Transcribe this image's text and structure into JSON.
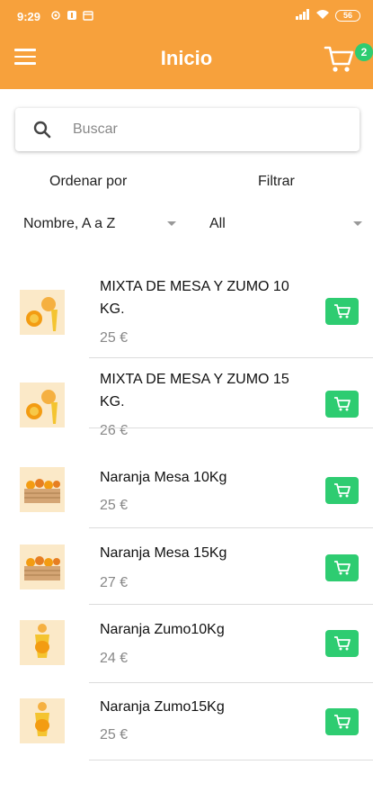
{
  "status_bar": {
    "time": "9:29",
    "battery": "56"
  },
  "app_bar": {
    "title": "Inicio",
    "cart_count": "2"
  },
  "search": {
    "placeholder": "Buscar"
  },
  "sort": {
    "label": "Ordenar por",
    "value": "Nombre, A a Z"
  },
  "filter": {
    "label": "Filtrar",
    "value": "All"
  },
  "colors": {
    "primary": "#f7a13c",
    "accent": "#2ecc71"
  },
  "products": [
    {
      "name": "MIXTA DE MESA Y ZUMO 10 KG.",
      "price": "25 €",
      "image": "mixed-orange-juice-icon"
    },
    {
      "name": "MIXTA DE MESA Y ZUMO 15 KG.",
      "price": "26 €",
      "image": "mixed-orange-juice-icon"
    },
    {
      "name": "Naranja Mesa 10Kg",
      "price": "25 €",
      "image": "orange-crate-icon"
    },
    {
      "name": "Naranja Mesa 15Kg",
      "price": "27 €",
      "image": "orange-crate-icon"
    },
    {
      "name": "Naranja Zumo10Kg",
      "price": "24 €",
      "image": "orange-juice-glass-icon"
    },
    {
      "name": "Naranja Zumo15Kg",
      "price": "25 €",
      "image": "orange-juice-glass-icon"
    }
  ]
}
